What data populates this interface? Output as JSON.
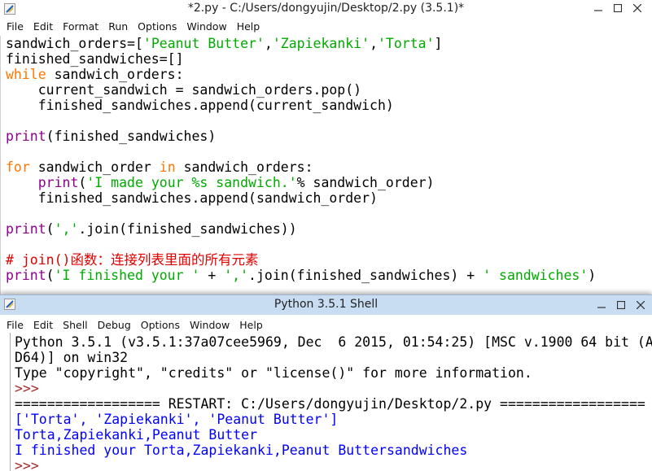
{
  "editor": {
    "title": "*2.py - C:/Users/dongyujin/Desktop/2.py (3.5.1)*",
    "menus": [
      "File",
      "Edit",
      "Format",
      "Run",
      "Options",
      "Window",
      "Help"
    ],
    "lines": [
      [
        {
          "t": "df",
          "s": "sandwich_orders=["
        },
        {
          "t": "str",
          "s": "'Peanut Butter'"
        },
        {
          "t": "df",
          "s": ","
        },
        {
          "t": "str",
          "s": "'Zapiekanki'"
        },
        {
          "t": "df",
          "s": ","
        },
        {
          "t": "str",
          "s": "'Torta'"
        },
        {
          "t": "df",
          "s": "]"
        }
      ],
      [
        {
          "t": "df",
          "s": "finished_sandwiches=[]"
        }
      ],
      [
        {
          "t": "kw",
          "s": "while"
        },
        {
          "t": "df",
          "s": " sandwich_orders:"
        }
      ],
      [
        {
          "t": "df",
          "s": "    current_sandwich = sandwich_orders.pop()"
        }
      ],
      [
        {
          "t": "df",
          "s": "    finished_sandwiches.append(current_sandwich)"
        }
      ],
      [],
      [
        {
          "t": "bi",
          "s": "print"
        },
        {
          "t": "df",
          "s": "(finished_sandwiches)"
        }
      ],
      [],
      [
        {
          "t": "kw",
          "s": "for"
        },
        {
          "t": "df",
          "s": " sandwich_order "
        },
        {
          "t": "kw",
          "s": "in"
        },
        {
          "t": "df",
          "s": " sandwich_orders:"
        }
      ],
      [
        {
          "t": "df",
          "s": "    "
        },
        {
          "t": "bi",
          "s": "print"
        },
        {
          "t": "df",
          "s": "("
        },
        {
          "t": "str",
          "s": "'I made your %s sandwich.'"
        },
        {
          "t": "df",
          "s": "% sandwich_order)"
        }
      ],
      [
        {
          "t": "df",
          "s": "    finished_sandwiches.append(sandwich_order)"
        }
      ],
      [],
      [
        {
          "t": "bi",
          "s": "print"
        },
        {
          "t": "df",
          "s": "("
        },
        {
          "t": "str",
          "s": "','"
        },
        {
          "t": "df",
          "s": ".join(finished_sandwiches))"
        }
      ],
      [],
      [
        {
          "t": "cm",
          "s": "# join()函数：连接列表里面的所有元素"
        }
      ],
      [
        {
          "t": "bi",
          "s": "print"
        },
        {
          "t": "df",
          "s": "("
        },
        {
          "t": "str",
          "s": "'I finished your '"
        },
        {
          "t": "df",
          "s": " + "
        },
        {
          "t": "str",
          "s": "','"
        },
        {
          "t": "df",
          "s": ".join(finished_sandwiches) + "
        },
        {
          "t": "str",
          "s": "' sandwiches'"
        },
        {
          "t": "df",
          "s": ")"
        }
      ]
    ]
  },
  "shell": {
    "title": "Python 3.5.1 Shell",
    "menus": [
      "File",
      "Edit",
      "Shell",
      "Debug",
      "Options",
      "Window",
      "Help"
    ],
    "lines": [
      [
        {
          "t": "df",
          "s": "Python 3.5.1 (v3.5.1:37a07cee5969, Dec  6 2015, 01:54:25) [MSC v.1900 64 bit (A"
        }
      ],
      [
        {
          "t": "df",
          "s": "D64)] on win32"
        }
      ],
      [
        {
          "t": "df",
          "s": "Type \"copyright\", \"credits\" or \"license()\" for more information."
        }
      ],
      [
        {
          "t": "pr",
          "s": ">>>"
        }
      ],
      [
        {
          "t": "df",
          "s": "================== RESTART: C:/Users/dongyujin/Desktop/2.py =================="
        }
      ],
      [
        {
          "t": "out",
          "s": "['Torta', 'Zapiekanki', 'Peanut Butter']"
        }
      ],
      [
        {
          "t": "out",
          "s": "Torta,Zapiekanki,Peanut Butter"
        }
      ],
      [
        {
          "t": "out",
          "s": "I finished your Torta,Zapiekanki,Peanut Buttersandwiches"
        }
      ],
      [
        {
          "t": "pr",
          "s": ">>>"
        }
      ]
    ]
  },
  "icons": {
    "app": "idle-feather-icon",
    "minimize": "minimize-icon",
    "maximize": "maximize-icon",
    "close": "close-icon"
  },
  "colors": {
    "keyword": "#ff7700",
    "builtin": "#900090",
    "string": "#00aa00",
    "comment": "#dd0000",
    "output": "#0000ff",
    "prompt": "#a52a2a",
    "shell_titlebar": "#c8dcf2"
  }
}
